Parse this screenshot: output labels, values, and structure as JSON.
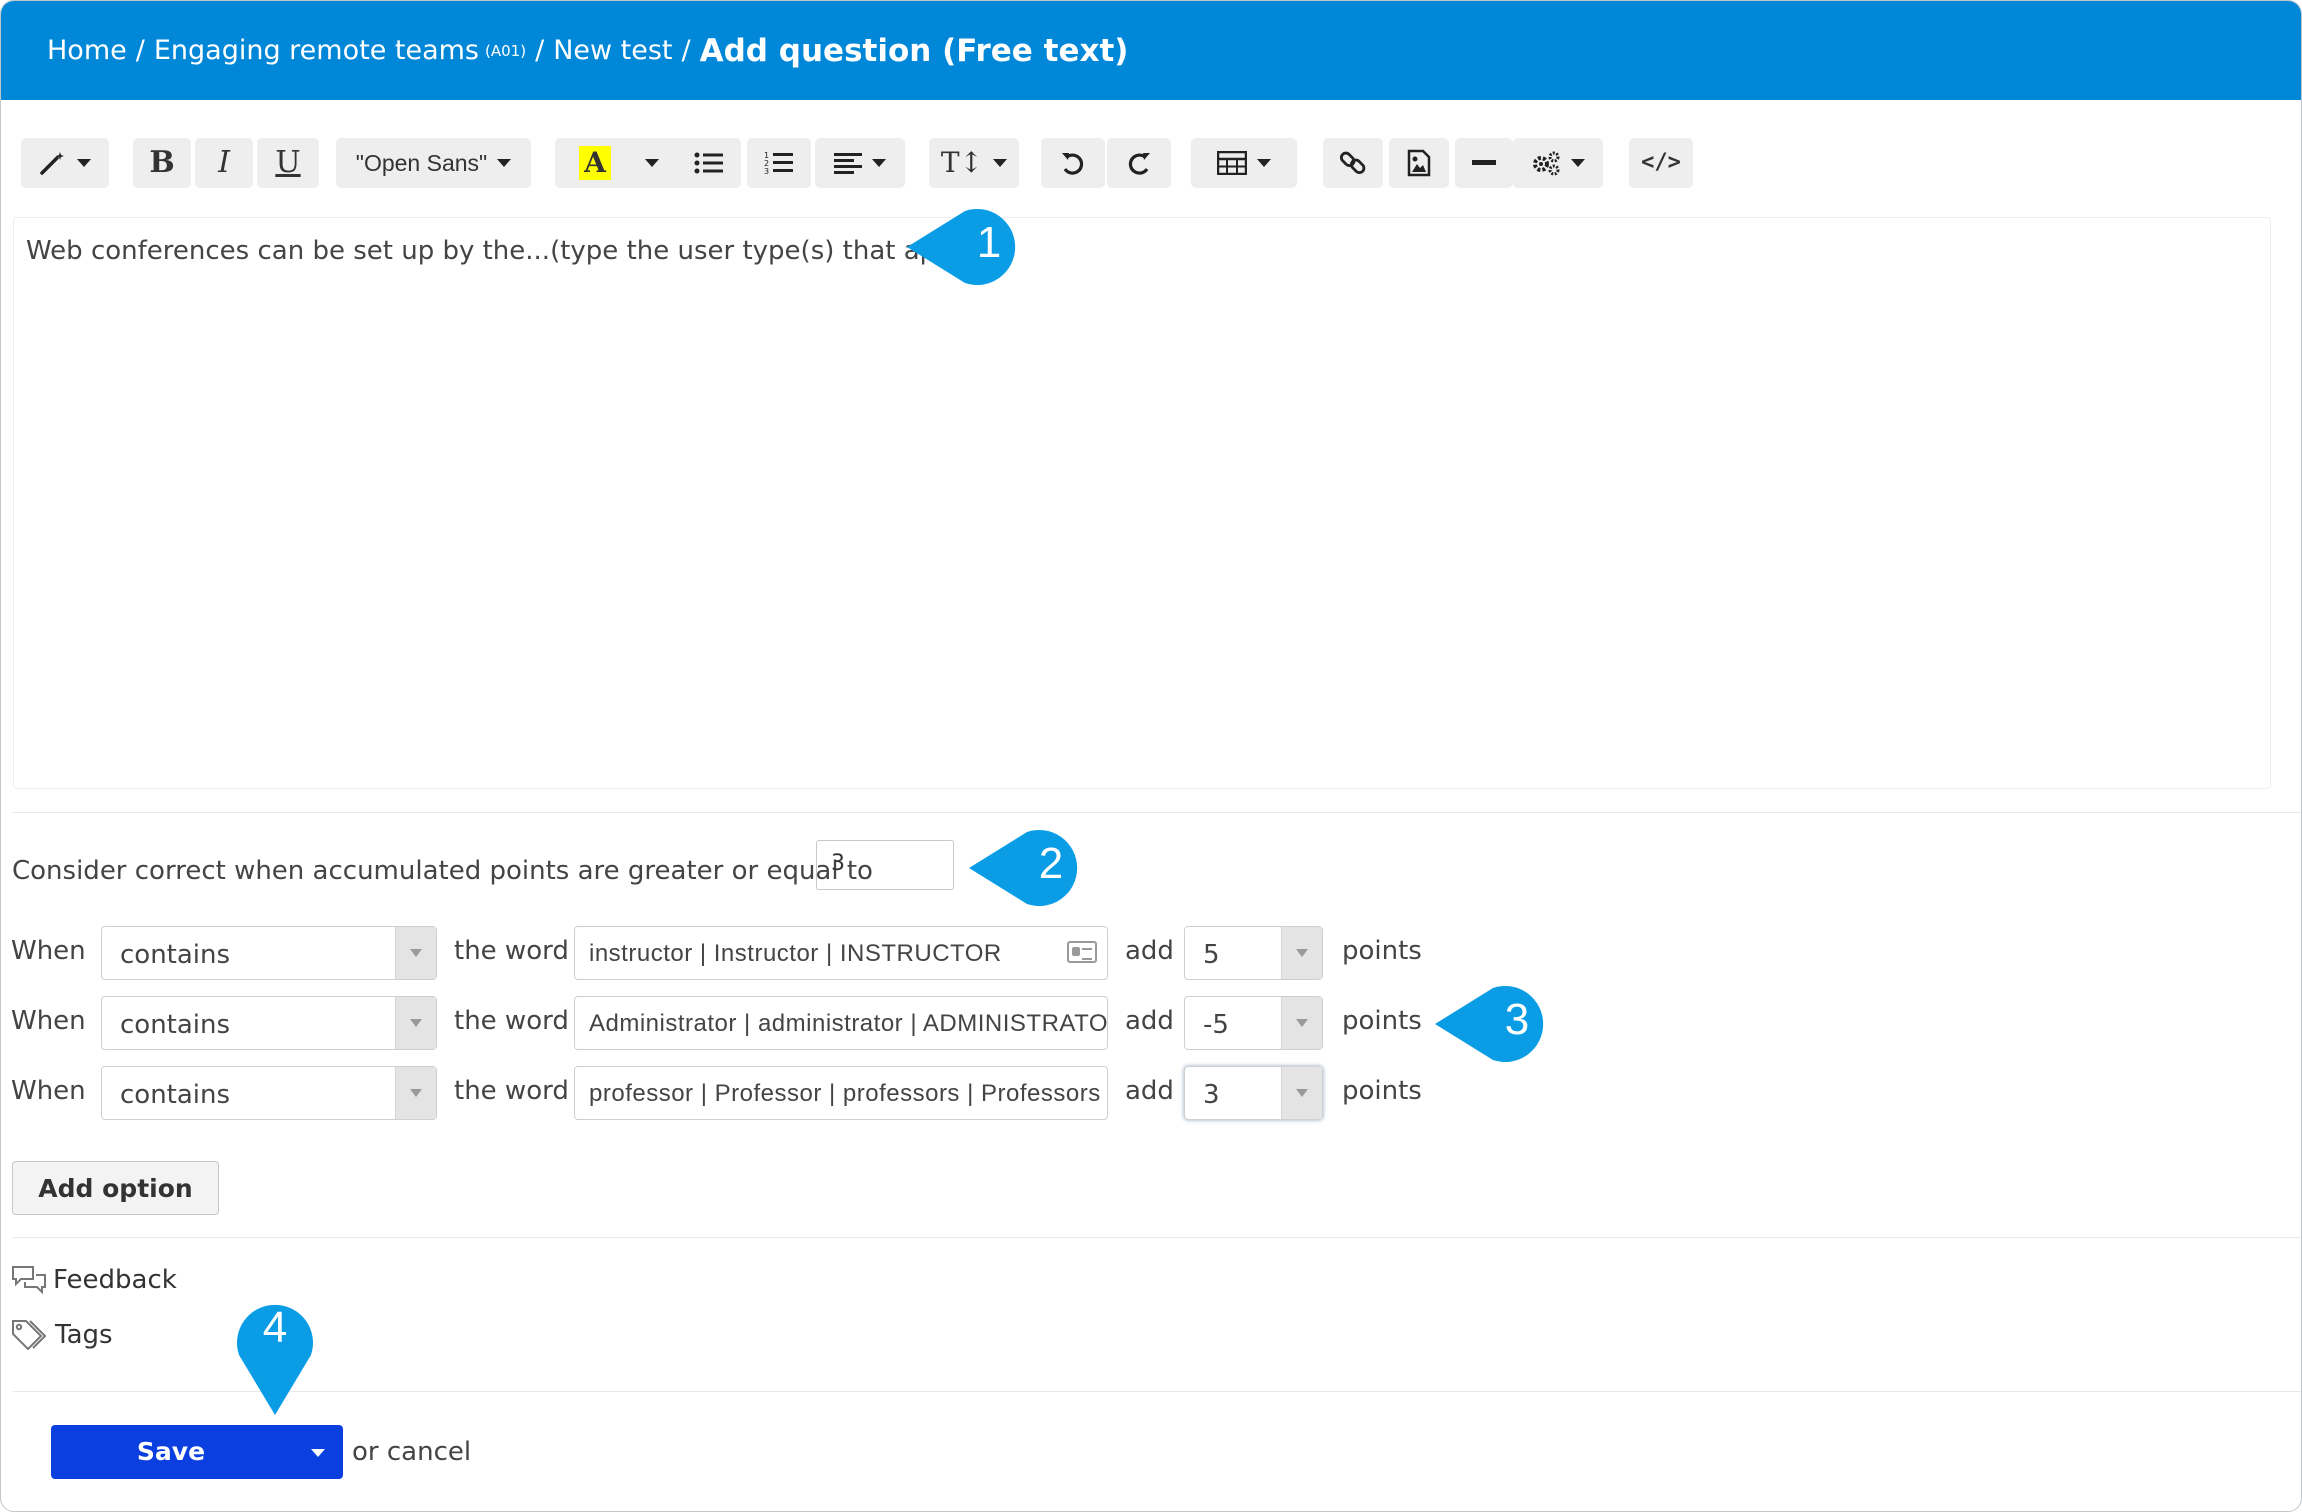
{
  "breadcrumb": {
    "home": "Home",
    "course": "Engaging remote teams",
    "course_code": "(A01)",
    "test": "New test",
    "current": "Add question (Free text)"
  },
  "toolbar": {
    "font_family": "\"Open Sans\"",
    "highlight_color": "#ffff00"
  },
  "editor": {
    "content": "Web conferences can be set up by the...(type the user type(s) that apply)"
  },
  "threshold": {
    "label": "Consider correct when accumulated points are greater or equal to",
    "value": "3"
  },
  "rules": [
    {
      "when": "When",
      "operator": "contains",
      "the_word": "the word",
      "words": "instructor | Instructor | INSTRUCTOR",
      "add": "add",
      "points_value": "5",
      "points": "points"
    },
    {
      "when": "When",
      "operator": "contains",
      "the_word": "the word",
      "words": "Administrator | administrator | ADMINISTRATOR",
      "add": "add",
      "points_value": "-5",
      "points": "points"
    },
    {
      "when": "When",
      "operator": "contains",
      "the_word": "the word",
      "words": "professor | Professor | professors | Professors",
      "add": "add",
      "points_value": "3",
      "points": "points"
    }
  ],
  "add_option_label": "Add option",
  "feedback_label": "Feedback",
  "tags_label": "Tags",
  "save_label": "Save",
  "cancel_label": "or cancel",
  "callouts": [
    "1",
    "2",
    "3",
    "4"
  ],
  "colors": {
    "header": "#0087d7",
    "callout": "#0a9de6",
    "save": "#0b3fe0"
  }
}
